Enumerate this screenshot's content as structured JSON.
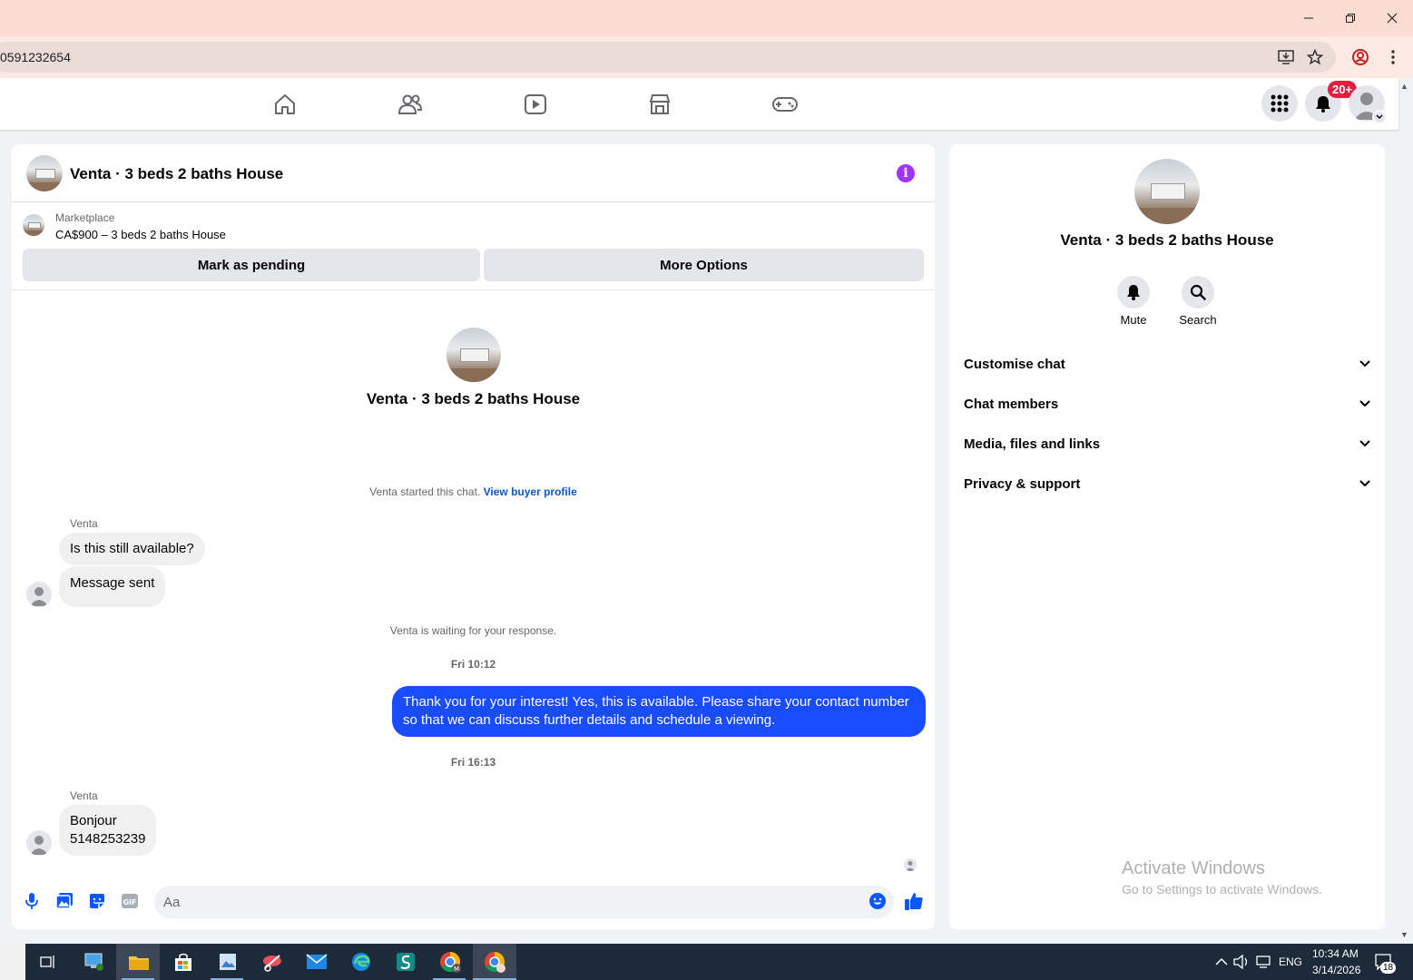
{
  "browser": {
    "url_fragment": "0591232654"
  },
  "notifications": {
    "badge": "20+"
  },
  "chat": {
    "title": "Venta · 3 beds 2 baths House",
    "marketplace_label": "Marketplace",
    "listing": "CA$900 – 3 beds 2 baths House",
    "mark_pending": "Mark as pending",
    "more_options": "More Options",
    "center_name": "Venta · 3 beds 2 baths House",
    "started_text": "Venta started this chat.",
    "view_buyer_profile": "View buyer profile",
    "messages": [
      {
        "sender": "Venta",
        "text": "Is this still available?"
      },
      {
        "text": "Message sent"
      }
    ],
    "waiting_text": "Venta is waiting for your response.",
    "time1": "Fri 10:12",
    "outgoing": "Thank you for your interest! Yes, this is available. Please share your contact number so that we can discuss further details and schedule a viewing.",
    "time2": "Fri 16:13",
    "last_sender": "Venta",
    "last_line1": "Bonjour",
    "last_line2": "5148253239",
    "composer_placeholder": "Aa"
  },
  "side": {
    "name": "Venta · 3 beds 2 baths House",
    "mute": "Mute",
    "search": "Search",
    "rows": [
      "Customise chat",
      "Chat members",
      "Media, files and links",
      "Privacy & support"
    ]
  },
  "watermark": {
    "line1": "Activate Windows",
    "line2": "Go to Settings to activate Windows."
  },
  "taskbar": {
    "lang": "ENG",
    "time": "10:34 AM",
    "date": "3/14/2026",
    "notif_count": "18"
  },
  "colors": {
    "accent": "#1a4cff",
    "info": "#a033ff",
    "link": "#0a58ca",
    "badge": "#e41e3f"
  }
}
